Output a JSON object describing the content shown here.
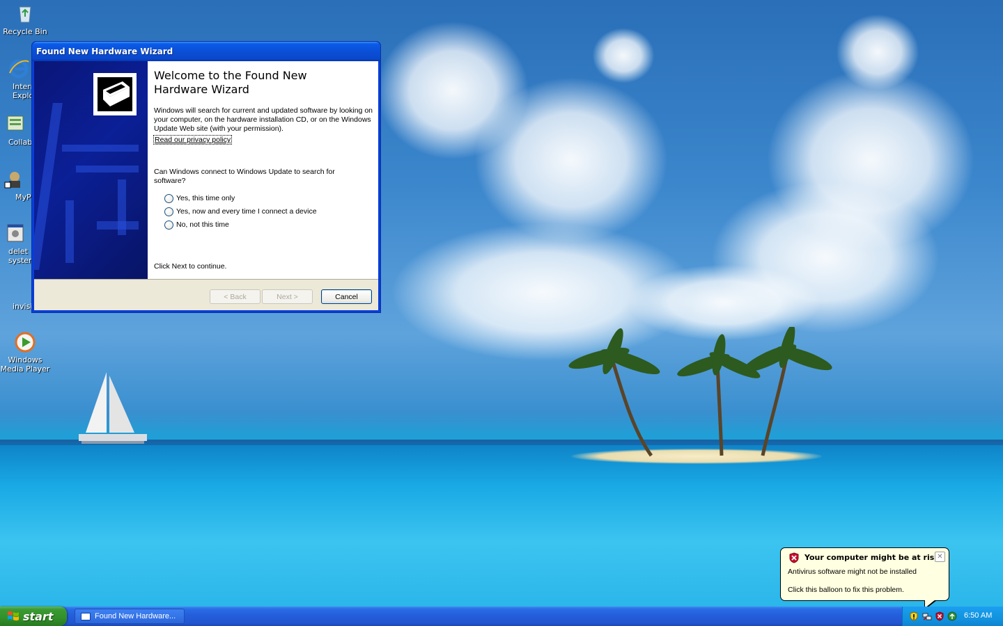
{
  "desktop": {
    "icons": [
      {
        "label": "Recycle Bin",
        "icon": "recycle-bin-icon"
      },
      {
        "label": "Intern\nExplor",
        "icon": "internet-explorer-icon"
      },
      {
        "label": "Collab",
        "icon": "collab-icon"
      },
      {
        "label": "MyP",
        "icon": "mypc-icon"
      },
      {
        "label": "delet\nsysten",
        "icon": "delete-system-icon"
      },
      {
        "label": "invisit",
        "icon": ""
      },
      {
        "label": "Windows\nMedia Player",
        "icon": "media-player-icon"
      }
    ]
  },
  "wizard": {
    "title": "Found New Hardware Wizard",
    "heading": "Welcome to the Found New Hardware Wizard",
    "intro": "Windows will search for current and updated software by looking on your computer, on the hardware installation CD, or on the Windows Update Web site (with your permission).",
    "privacy_link": "Read our privacy policy",
    "question": "Can Windows connect to Windows Update to search for software?",
    "options": [
      {
        "label": "Yes, this time only",
        "selected": false
      },
      {
        "label": "Yes, now and every time I connect a device",
        "selected": false
      },
      {
        "label": "No, not this time",
        "selected": false
      }
    ],
    "footer_text": "Click Next to continue.",
    "buttons": {
      "back": "< Back",
      "next": "Next >",
      "cancel": "Cancel"
    }
  },
  "balloon": {
    "title": "Your computer might be at risk",
    "line1": "Antivirus software might not be installed",
    "line2": "Click this balloon to fix this problem.",
    "icon": "security-shield-icon"
  },
  "taskbar": {
    "start_label": "start",
    "task_button_label": "Found New Hardware...",
    "tray_icons": [
      "security-alert-icon",
      "network-icon",
      "security-center-icon",
      "update-icon"
    ],
    "clock": "6:50 AM"
  },
  "colors": {
    "title_blue": "#0a4fd6",
    "start_green": "#33912a",
    "tray_blue": "#1190dd",
    "balloon_yellow": "#ffffe1",
    "banner_navy": "#0b1f96"
  }
}
